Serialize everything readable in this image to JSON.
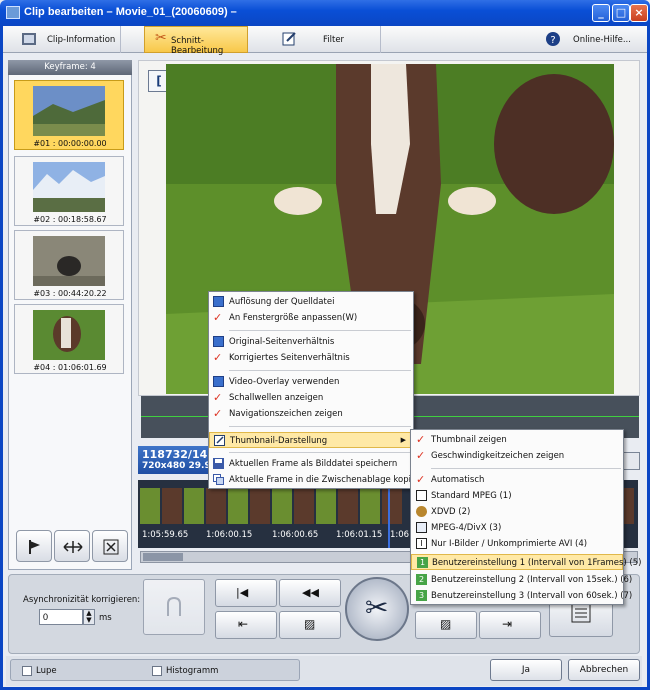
{
  "window": {
    "title": "Clip bearbeiten – Movie_01_(20060609) –"
  },
  "tabs": [
    {
      "label": "Clip-Information"
    },
    {
      "label": "Schnitt-Bearbeitung"
    },
    {
      "label": "Filter"
    },
    {
      "label": "Online-Hilfe..."
    }
  ],
  "sidebar": {
    "header": "Keyframe: 4",
    "keyframes": [
      {
        "label": "#01 : 00:00:00.00"
      },
      {
        "label": "#02 : 00:18:58.67"
      },
      {
        "label": "#03 : 00:44:20.22"
      },
      {
        "label": "#04 : 01:06:01.69"
      }
    ]
  },
  "info": {
    "frame": "118732/1425",
    "res": "720x480 29.97"
  },
  "timeline": {
    "labels": [
      "1:05:59.65",
      "1:06:00.15",
      "1:06:00.65",
      "1:06:01.15",
      "1:06"
    ]
  },
  "context_menu": {
    "items": [
      "Auflösung der Quelldatei",
      "An Fenstergröße anpassen(W)",
      "Original-Seitenverhältnis",
      "Korrigiertes Seitenverhältnis",
      "Video-Overlay verwenden",
      "Schallwellen anzeigen",
      "Navigationszeichen zeigen",
      "Thumbnail-Darstellung",
      "Aktuellen Frame als Bilddatei speichern",
      "Aktuelle Frame in die Zwischenablage kopieren"
    ]
  },
  "submenu": {
    "items": [
      "Thumbnail zeigen",
      "Geschwindigkeitzeichen zeigen",
      "Automatisch",
      "Standard MPEG (1)",
      "XDVD (2)",
      "MPEG-4/DivX (3)",
      "Nur I-Bilder / Unkomprimierte AVI (4)",
      "Benutzereinstellung 1 (Intervall von 1Frames) (5)",
      "Benutzereinstellung 2 (Intervall von 15sek.) (6)",
      "Benutzereinstellung 3 (Intervall von 60sek.) (7)"
    ]
  },
  "controls": {
    "async_label": "Asynchronizität korrigieren:",
    "async_value": "0",
    "unit": "ms"
  },
  "status": {
    "lupe": "Lupe",
    "histogramm": "Histogramm",
    "ok": "Ja",
    "cancel": "Abbrechen"
  }
}
